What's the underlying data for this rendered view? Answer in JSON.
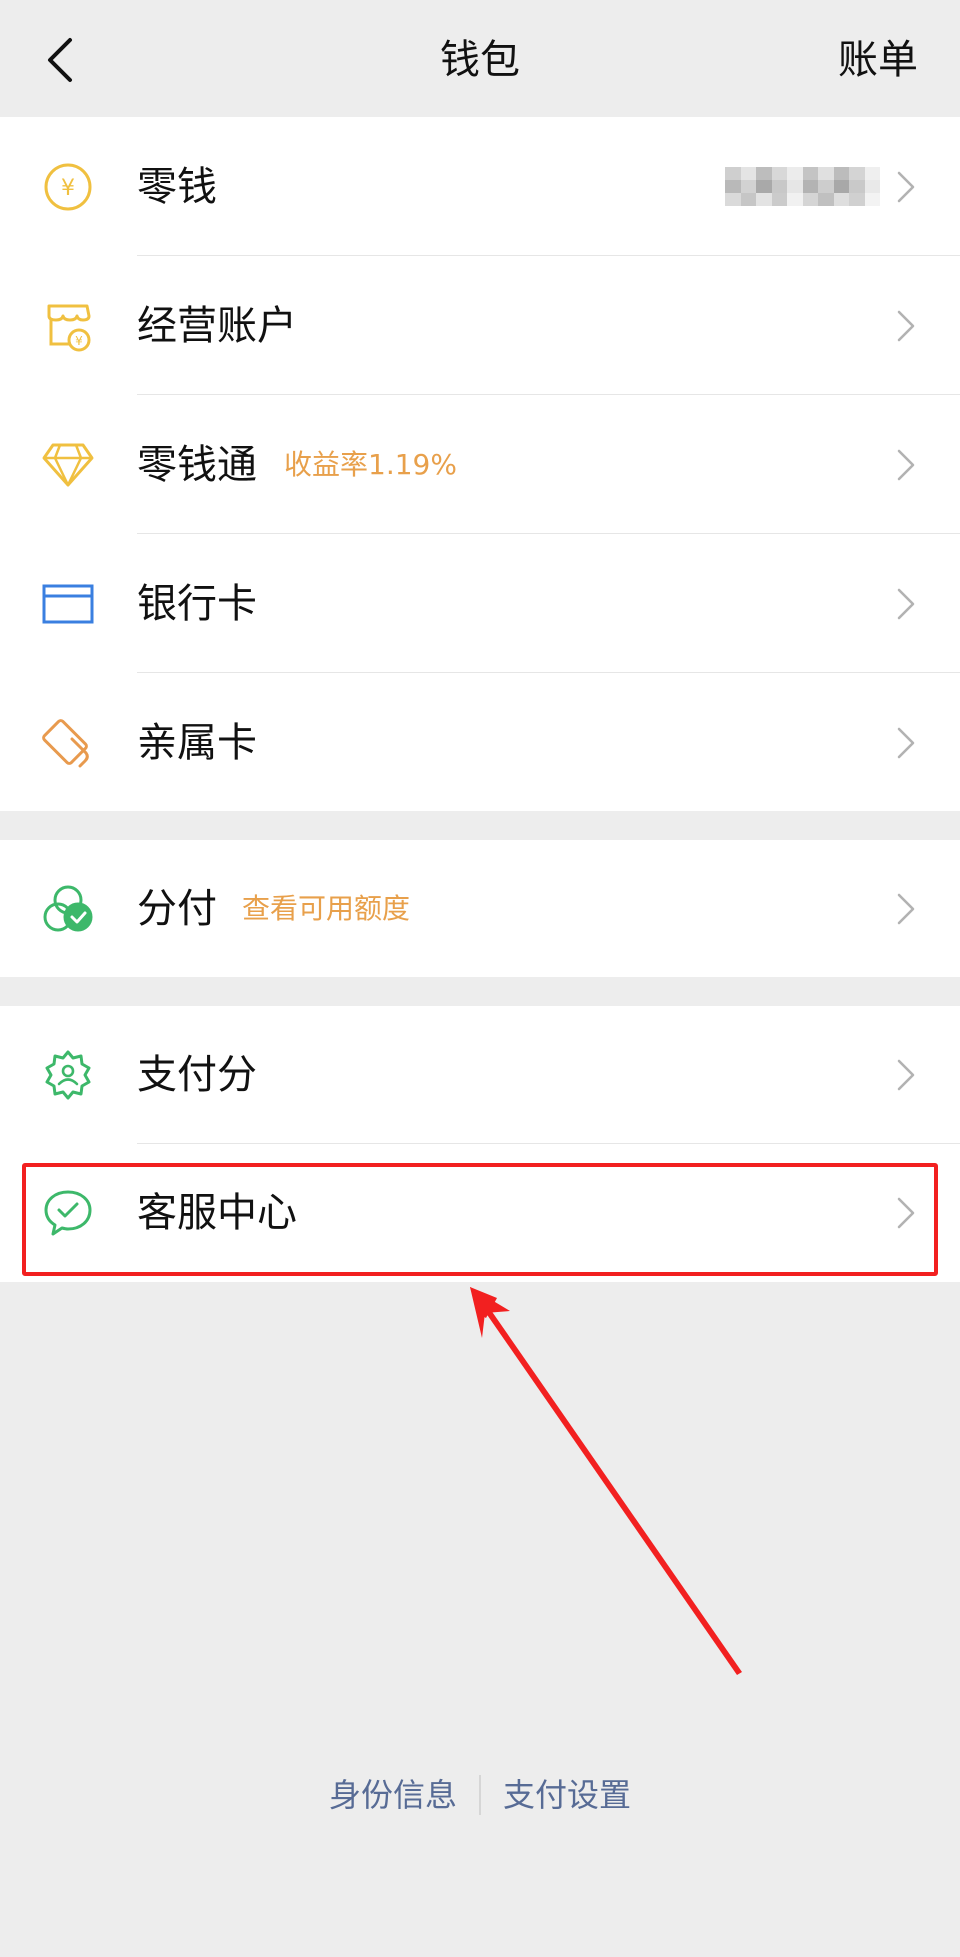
{
  "nav": {
    "title": "钱包",
    "bill": "账单"
  },
  "groups": [
    {
      "items": [
        {
          "id": "change",
          "label": "零钱",
          "icon": "yuan-coin-icon",
          "tag": "",
          "value": "blurred"
        },
        {
          "id": "business",
          "label": "经营账户",
          "icon": "shop-account-icon",
          "tag": ""
        },
        {
          "id": "lingqiantong",
          "label": "零钱通",
          "icon": "diamond-icon",
          "tag": "收益率1.19%"
        },
        {
          "id": "bank-card",
          "label": "银行卡",
          "icon": "bank-card-icon",
          "tag": ""
        },
        {
          "id": "family-card",
          "label": "亲属卡",
          "icon": "family-card-icon",
          "tag": ""
        }
      ]
    },
    {
      "items": [
        {
          "id": "installment",
          "label": "分付",
          "icon": "installment-icon",
          "tag": "查看可用额度"
        }
      ]
    },
    {
      "items": [
        {
          "id": "pay-score",
          "label": "支付分",
          "icon": "pay-score-icon",
          "tag": ""
        },
        {
          "id": "service-center",
          "label": "客服中心",
          "icon": "service-chat-icon",
          "tag": ""
        }
      ]
    }
  ],
  "footer": {
    "identity": "身份信息",
    "pay_settings": "支付设置"
  },
  "colors": {
    "background": "#ededed",
    "tag": "#e8a04b",
    "link": "#576b95",
    "highlight": "#f22020",
    "icon_yellow": "#f0c040",
    "icon_blue": "#3a7fe0",
    "icon_orange": "#e89a4e",
    "icon_green": "#3db86a"
  }
}
